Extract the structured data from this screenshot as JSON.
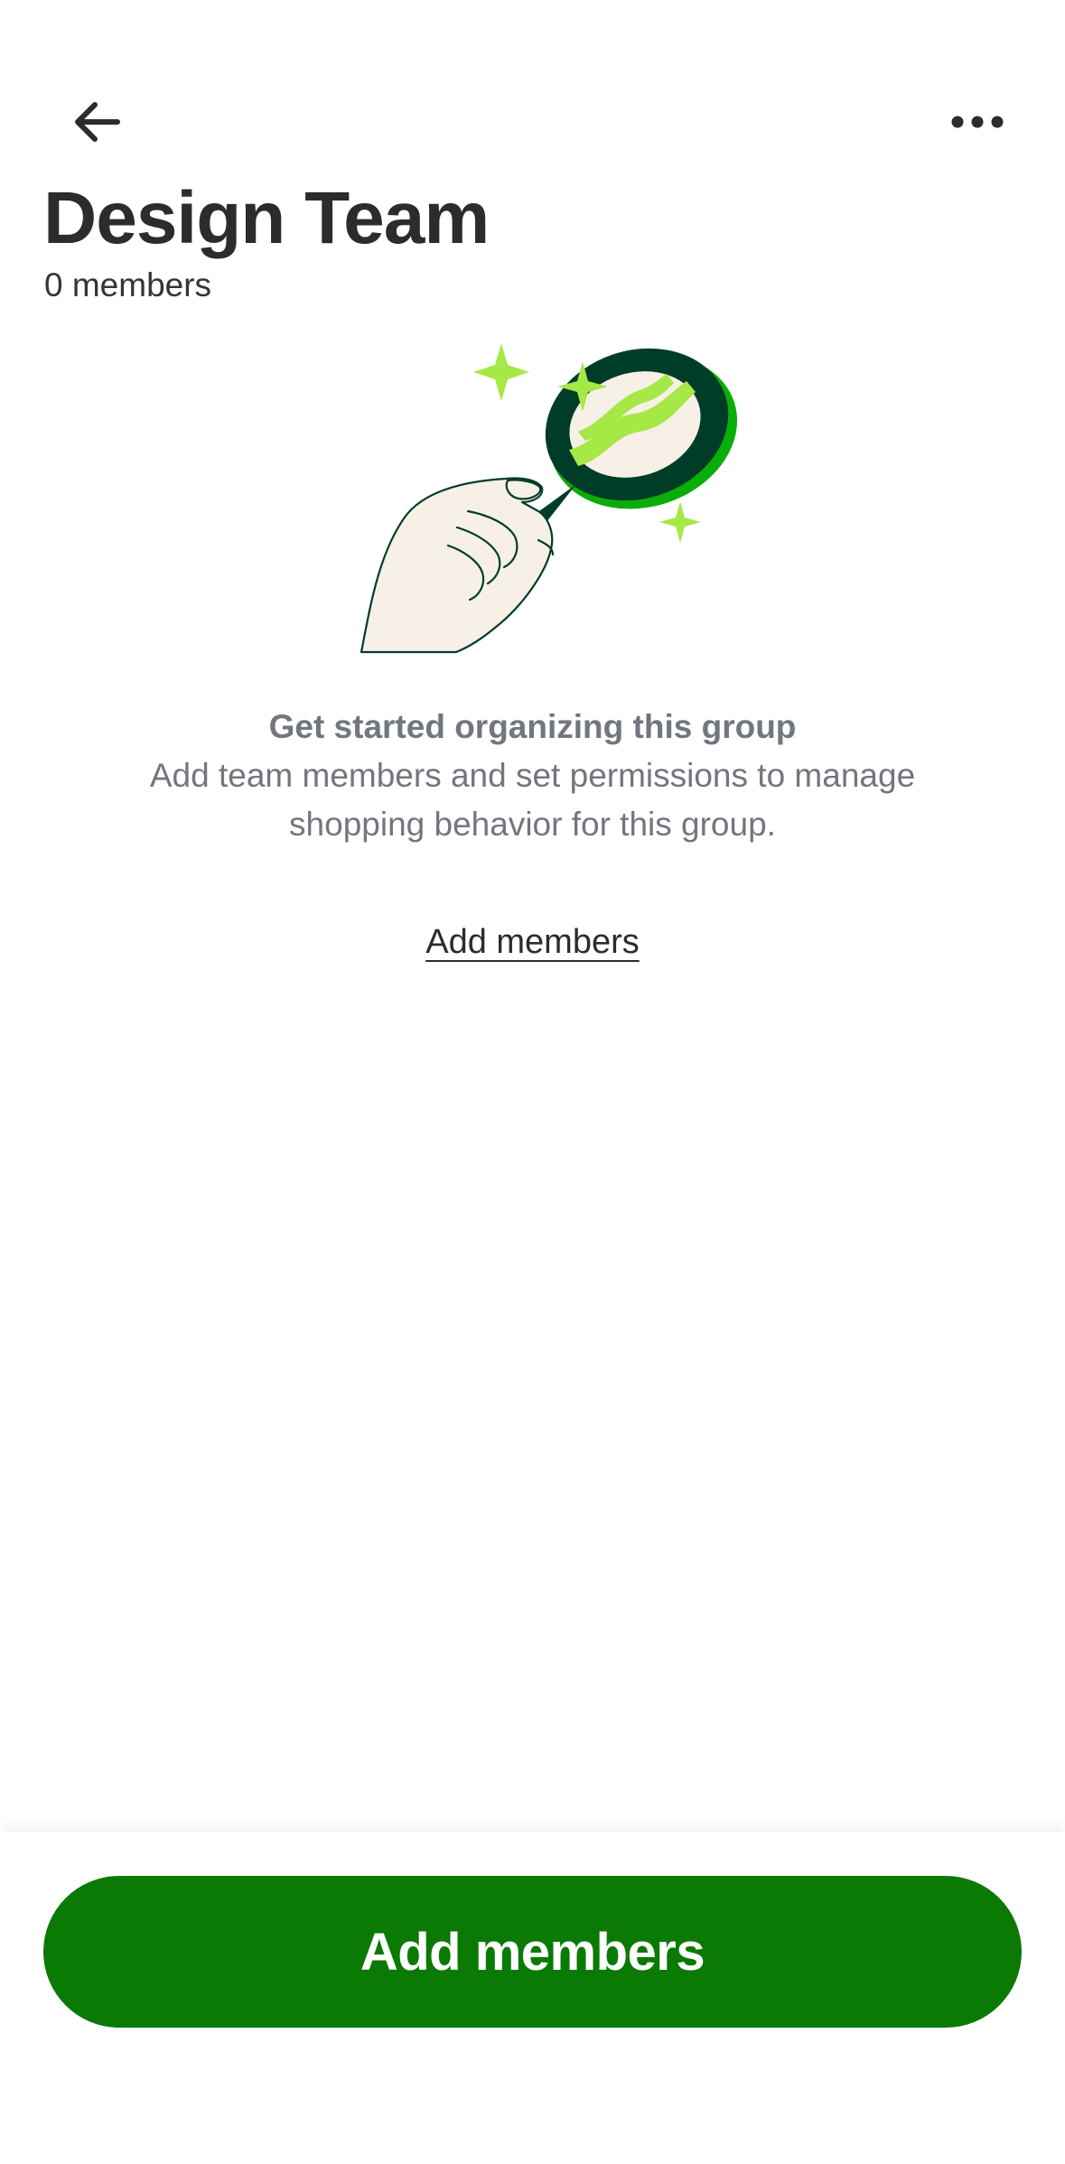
{
  "header": {
    "back_icon": "arrow-left-icon",
    "more_icon": "more-horizontal-icon"
  },
  "group": {
    "title": "Design Team",
    "member_count": "0 members"
  },
  "empty_state": {
    "illustration": "hand-holding-magnifying-glass",
    "heading": "Get started organizing this group",
    "body": "Add team members and set permissions to manage shopping behavior for this group.",
    "link_label": "Add members"
  },
  "footer": {
    "primary_button_label": "Add members"
  },
  "colors": {
    "primary_green": "#0a7a05",
    "dark_green": "#003d29",
    "lime": "#a6e845",
    "cream": "#f7f0e6",
    "text_dark": "#2b2c2e",
    "text_muted": "#72767e"
  }
}
